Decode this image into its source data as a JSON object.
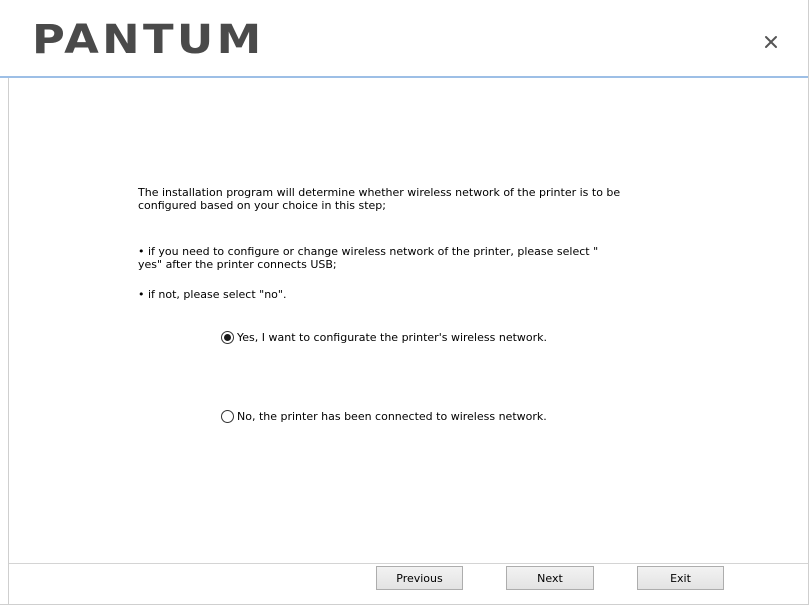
{
  "header": {
    "brand": "PANTUM",
    "close_symbol": "×"
  },
  "main": {
    "intro_line1": "The installation program will determine whether wireless network of the printer is to be",
    "intro_line2": "configured based on your choice in this step;",
    "bullet1_line1": "• if you need to configure or change wireless network of the printer, please select \"",
    "bullet1_line2": "yes\" after the printer connects USB;",
    "bullet2": "• if not, please select \"no\".",
    "options": [
      {
        "label": "Yes, I want to configurate the printer's wireless network.",
        "selected": true
      },
      {
        "label": "No, the printer has been connected to wireless network.",
        "selected": false
      }
    ]
  },
  "footer": {
    "previous_label": "Previous",
    "next_label": "Next",
    "exit_label": "Exit"
  },
  "colors": {
    "header_rule": "#9dbfe6",
    "logo": "#4a4a4a"
  },
  "icons": {
    "close": "close-icon",
    "radio_selected": "radio-selected-icon",
    "radio_unselected": "radio-unselected-icon"
  }
}
